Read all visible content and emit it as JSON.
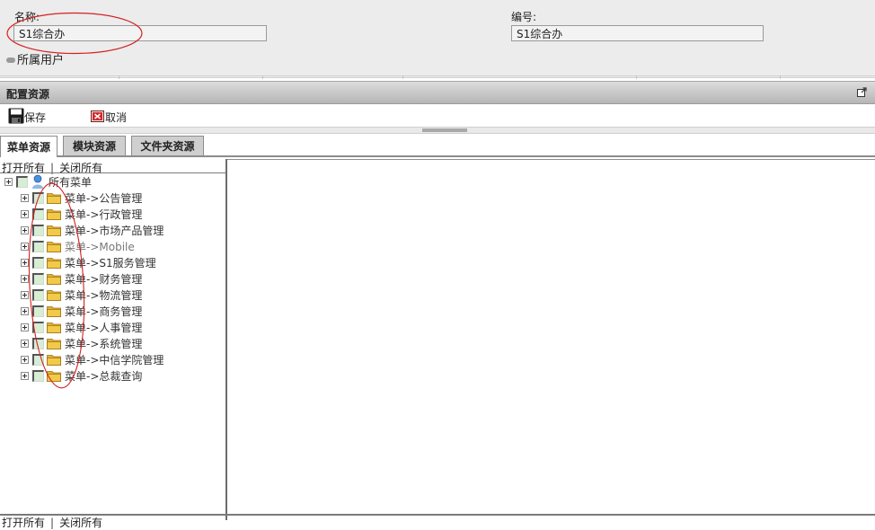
{
  "form": {
    "name_label": "名称:",
    "name_value": "S1综合办",
    "code_label": "编号:",
    "code_value": "S1综合办",
    "owner_label": "所属用户"
  },
  "panel": {
    "title": "配置资源"
  },
  "toolbar": {
    "save_label": "保存",
    "cancel_label": "取消"
  },
  "tabs": [
    {
      "label": "菜单资源",
      "active": true
    },
    {
      "label": "模块资源",
      "active": false
    },
    {
      "label": "文件夹资源",
      "active": false
    }
  ],
  "tree": {
    "open_all": "打开所有",
    "close_all": "关闭所有",
    "root": {
      "label": "所有菜单",
      "icon": "globe-user-icon"
    },
    "items": [
      {
        "label": "菜单->公告管理"
      },
      {
        "label": "菜单->行政管理"
      },
      {
        "label": "菜单->市场产品管理"
      },
      {
        "label": "菜单->Mobile"
      },
      {
        "label": "菜单->S1服务管理"
      },
      {
        "label": "菜单->财务管理"
      },
      {
        "label": "菜单->物流管理"
      },
      {
        "label": "菜单->商务管理"
      },
      {
        "label": "菜单->人事管理"
      },
      {
        "label": "菜单->系统管理"
      },
      {
        "label": "菜单->中信学院管理"
      },
      {
        "label": "菜单->总裁查询"
      }
    ]
  },
  "colors": {
    "annotation": "#d62020",
    "checkbox_fill": "#d8ecd6",
    "folder": "#f3c94a"
  }
}
